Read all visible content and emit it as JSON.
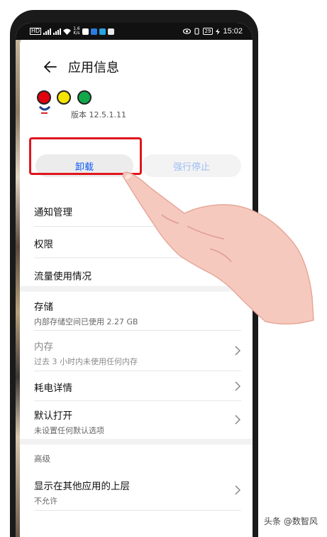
{
  "status_bar": {
    "left_network": "HD",
    "speed_top": "1.6",
    "speed_bottom": "K/s",
    "battery": "29",
    "time": "15:02"
  },
  "header": {
    "back_icon": "arrow-left-icon",
    "title": "应用信息"
  },
  "app": {
    "version": "版本 12.5.1.11",
    "dot_colors": [
      "#e2000f",
      "#f4e400",
      "#11a84a"
    ]
  },
  "actions": {
    "uninstall_label": "卸载",
    "force_stop_label": "强行停止",
    "highlight_color": "#e0161d"
  },
  "settings": {
    "notifications": "通知管理",
    "permissions": "权限",
    "data_usage": "流量使用情况",
    "storage_title": "存储",
    "storage_sub": "内部存储空间已使用 2.27 GB",
    "memory_title": "内存",
    "memory_sub": "过去 3 小时内未使用任何内存",
    "battery_title": "耗电详情",
    "default_open_title": "默认打开",
    "default_open_sub": "未设置任何默认选项",
    "advanced_header": "高级",
    "overlay_title": "显示在其他应用的上层",
    "overlay_sub": "不允许"
  },
  "watermark": "头条 @数智风",
  "accent_color": "#0a59f7"
}
